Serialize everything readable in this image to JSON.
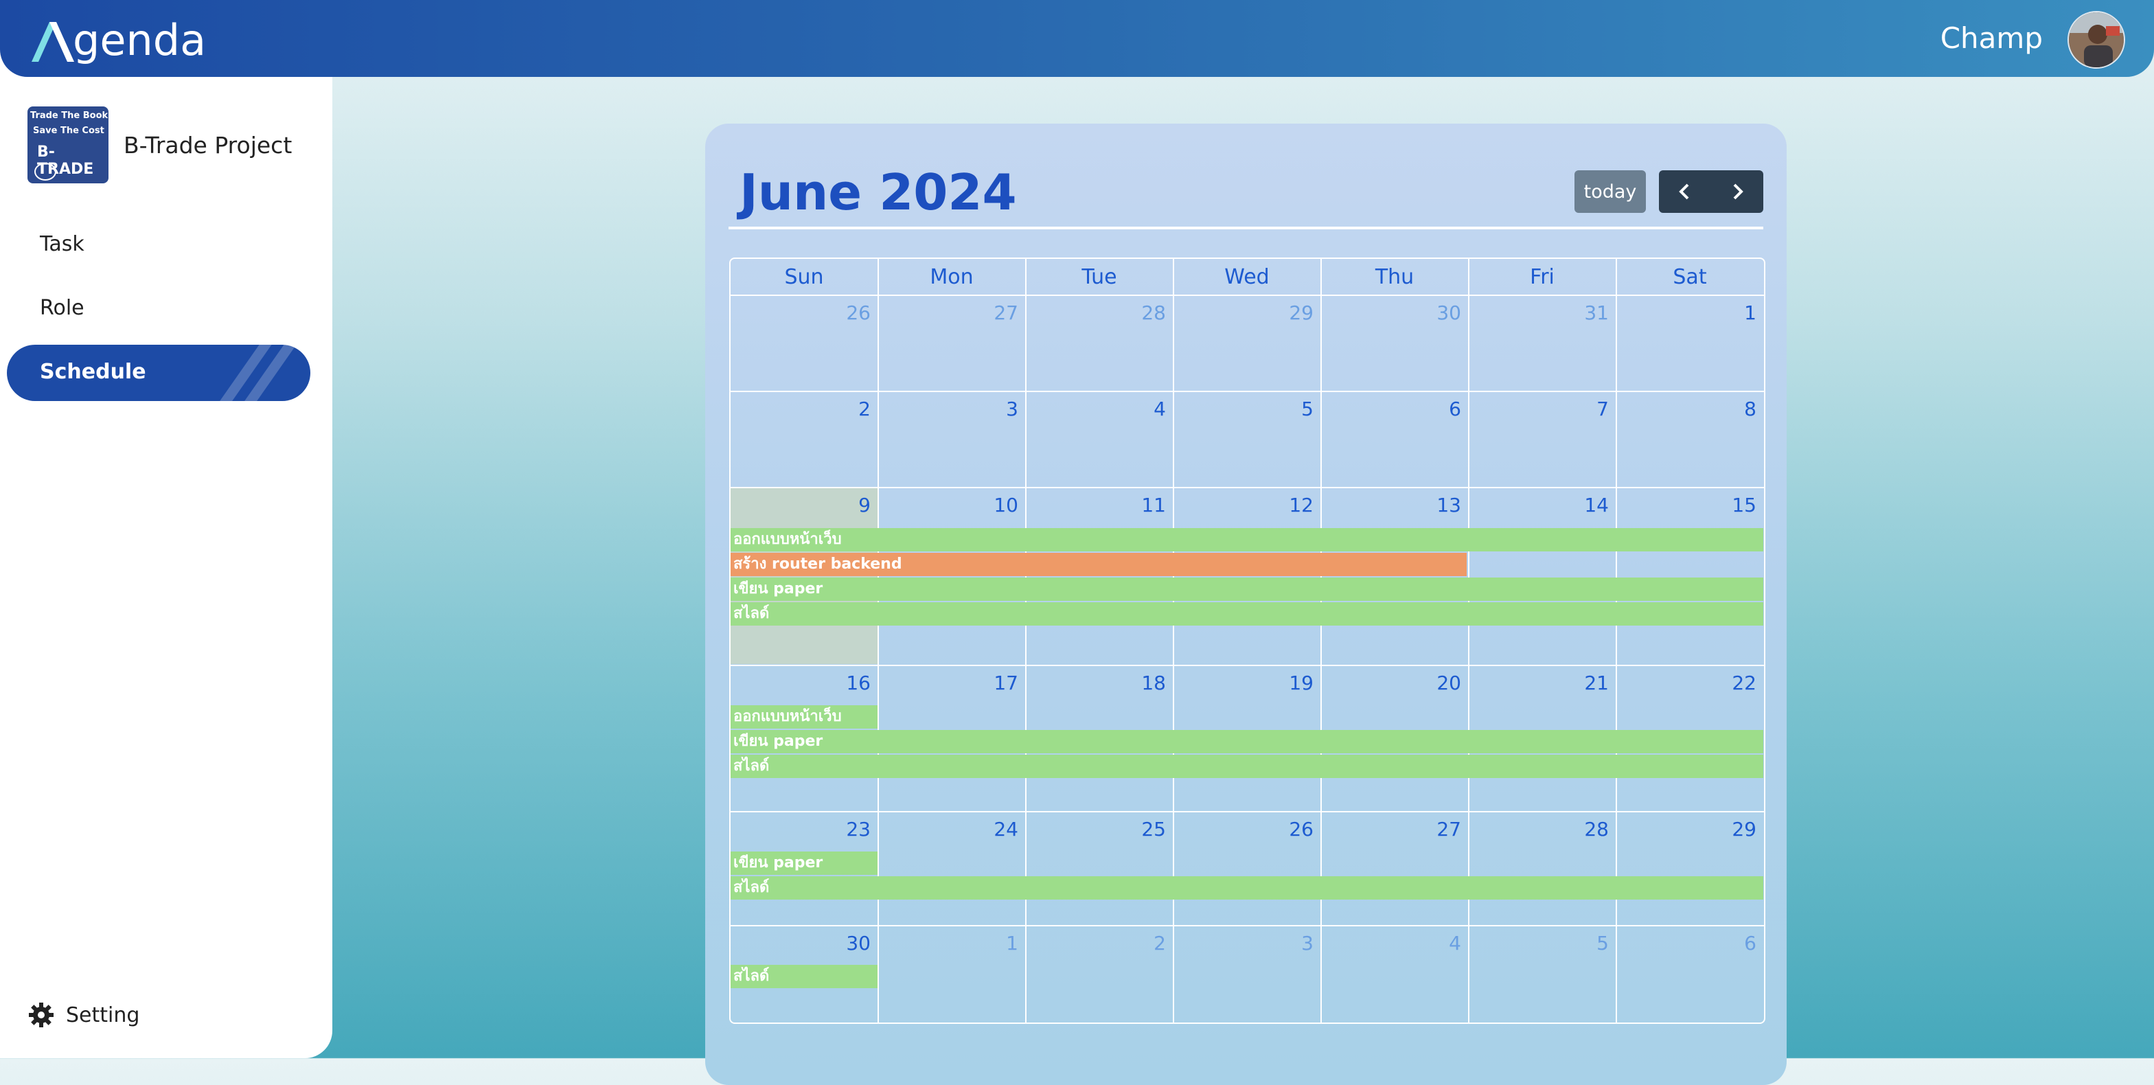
{
  "app": {
    "logo_text": "genda",
    "user_name": "Champ"
  },
  "sidebar": {
    "project_name": "B-Trade Project",
    "project_logo_lines": [
      "Trade The Book",
      "Save The Cost",
      "B-TRADE"
    ],
    "nav": [
      {
        "label": "Task"
      },
      {
        "label": "Role"
      },
      {
        "label": "Schedule",
        "active": true
      }
    ],
    "setting_label": "Setting"
  },
  "calendar": {
    "title": "June 2024",
    "today_label": "today",
    "weekdays": [
      "Sun",
      "Mon",
      "Tue",
      "Wed",
      "Thu",
      "Fri",
      "Sat"
    ],
    "weeks": [
      [
        "26",
        "27",
        "28",
        "29",
        "30",
        "31",
        "1"
      ],
      [
        "2",
        "3",
        "4",
        "5",
        "6",
        "7",
        "8"
      ],
      [
        "9",
        "10",
        "11",
        "12",
        "13",
        "14",
        "15"
      ],
      [
        "16",
        "17",
        "18",
        "19",
        "20",
        "21",
        "22"
      ],
      [
        "23",
        "24",
        "25",
        "26",
        "27",
        "28",
        "29"
      ],
      [
        "30",
        "1",
        "2",
        "3",
        "4",
        "5",
        "6"
      ]
    ],
    "other_month": [
      [
        true,
        true,
        true,
        true,
        true,
        true,
        false
      ],
      [
        false,
        false,
        false,
        false,
        false,
        false,
        false
      ],
      [
        false,
        false,
        false,
        false,
        false,
        false,
        false
      ],
      [
        false,
        false,
        false,
        false,
        false,
        false,
        false
      ],
      [
        false,
        false,
        false,
        false,
        false,
        false,
        false
      ],
      [
        false,
        true,
        true,
        true,
        true,
        true,
        true
      ]
    ],
    "events": {
      "design_web": "ออกแบบหน้าเว็บ",
      "router_backend": "สร้าง router backend",
      "write_paper": "เขียน paper",
      "slides": "สไลด์"
    },
    "colors": {
      "green": "#9ddd8a",
      "orange": "#ee9a67",
      "accent": "#1d5bd0"
    }
  }
}
